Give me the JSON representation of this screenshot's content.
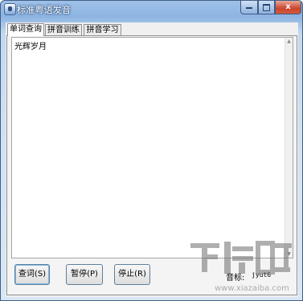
{
  "window": {
    "title": "标准粤语发音",
    "controls": {
      "minimize_icon": "minimize-icon",
      "maximize_icon": "maximize-icon",
      "close_label": "x"
    }
  },
  "tabs": [
    {
      "label": "单词查询",
      "active": true
    },
    {
      "label": "拼音训练",
      "active": false
    },
    {
      "label": "拼音学习",
      "active": false
    }
  ],
  "main": {
    "input_text": "光辉岁月"
  },
  "buttons": {
    "query": "查词(S)",
    "pause": "暂停(P)",
    "stop": "停止(R)"
  },
  "pinyin": {
    "label": "音标:",
    "value": "jyut6"
  },
  "watermark": {
    "logo_text": "下载吧",
    "site_text": "www.xiazaiba.com"
  },
  "colors": {
    "titlebar": "#8db4e2",
    "close_button": "#c9452e"
  }
}
